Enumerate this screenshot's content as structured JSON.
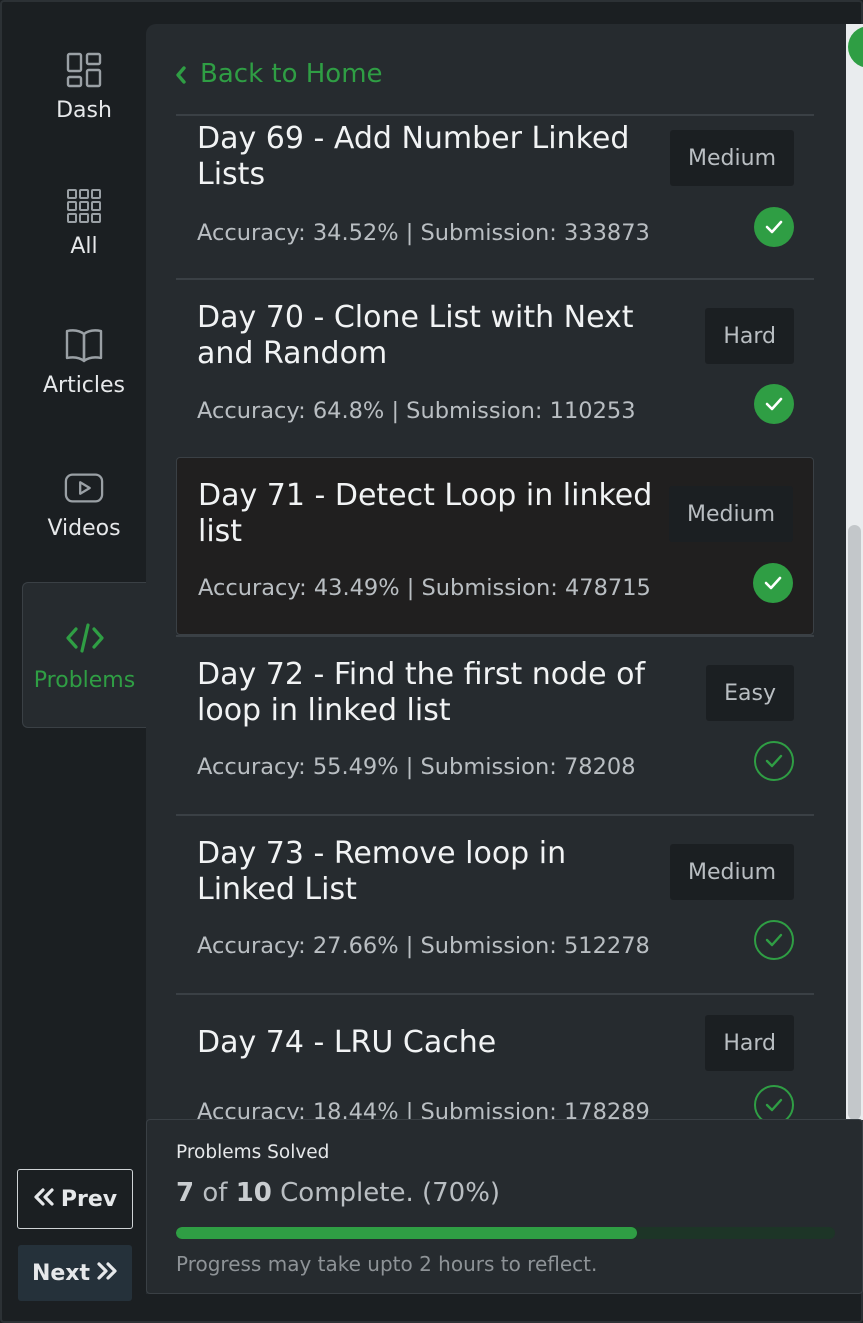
{
  "sidebar": {
    "items": [
      {
        "label": "Dash",
        "icon": "dashboard-icon"
      },
      {
        "label": "All",
        "icon": "grid-icon"
      },
      {
        "label": "Articles",
        "icon": "book-icon"
      },
      {
        "label": "Videos",
        "icon": "video-icon"
      },
      {
        "label": "Problems",
        "icon": "code-icon",
        "active": true
      }
    ],
    "prev_label": "Prev",
    "next_label": "Next"
  },
  "header": {
    "back_label": "Back to Home"
  },
  "problems": [
    {
      "title": "Day 69 - Add Number Linked Lists",
      "stats": "Accuracy: 34.52% | Submission: 333873",
      "difficulty": "Medium",
      "status": "solved"
    },
    {
      "title": "Day 70 - Clone List with Next and Random",
      "stats": "Accuracy: 64.8% | Submission: 110253",
      "difficulty": "Hard",
      "status": "solved"
    },
    {
      "title": "Day 71 - Detect Loop in linked list",
      "stats": "Accuracy: 43.49% | Submission: 478715",
      "difficulty": "Medium",
      "status": "solved"
    },
    {
      "title": "Day 72 - Find the first node of loop in linked list",
      "stats": "Accuracy: 55.49% | Submission: 78208",
      "difficulty": "Easy",
      "status": "unsolved"
    },
    {
      "title": "Day 73 - Remove loop in Linked List",
      "stats": "Accuracy: 27.66% | Submission: 512278",
      "difficulty": "Medium",
      "status": "unsolved"
    },
    {
      "title": "Day 74 - LRU Cache",
      "stats": "Accuracy: 18.44% | Submission: 178289",
      "difficulty": "Hard",
      "status": "unsolved"
    }
  ],
  "progress": {
    "label": "Problems Solved",
    "solved": "7",
    "of_text": "of",
    "total": "10",
    "suffix": "Complete. (70%)",
    "fraction": 0.7,
    "note": "Progress may take upto 2 hours to reflect."
  },
  "colors": {
    "accent": "#2f9e44",
    "panel": "#262b2f",
    "background": "#1b1f22"
  }
}
